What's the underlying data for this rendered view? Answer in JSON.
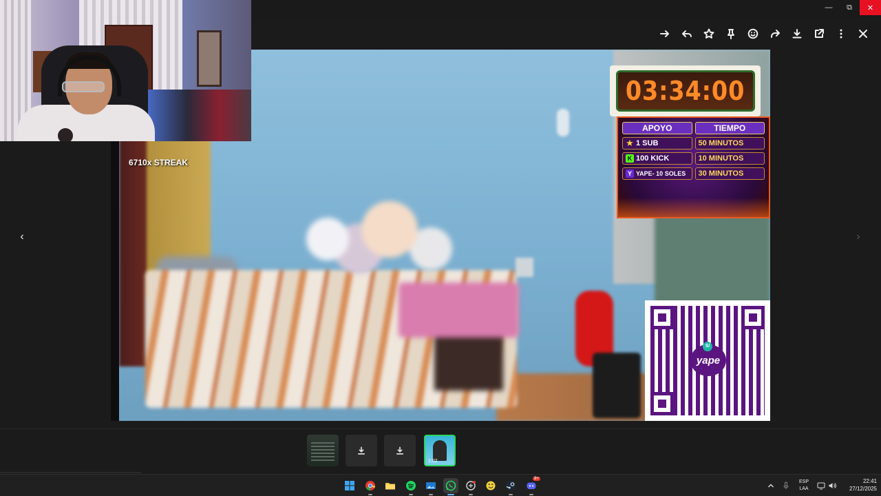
{
  "window": {
    "minimize_glyph": "—",
    "maximize_glyph": "⧉",
    "close_glyph": "✕"
  },
  "toolbar": {
    "buttons": [
      "forward-icon",
      "reply-icon",
      "star-icon",
      "pin-icon",
      "emoji-icon",
      "share-icon",
      "download-icon",
      "open-external-icon",
      "more-vertical-icon",
      "close-icon"
    ]
  },
  "overlay": {
    "streak": "6710x STREAK",
    "timer": "03:34:00",
    "support": {
      "header_left": "APOYO",
      "header_right": "TIEMPO",
      "rows": [
        {
          "left": "1 SUB",
          "right": "50 MINUTOS"
        },
        {
          "left": "100 KICK",
          "right": "10 MINUTOS"
        },
        {
          "left": "YAPE- 10 SOLES",
          "right": "30 MINUTOS"
        }
      ]
    },
    "qr_logo": "yape",
    "qr_badge": "S/"
  },
  "nav": {
    "prev": "‹",
    "next": "›"
  },
  "filmstrip": {
    "thumbs": [
      "document",
      "download",
      "download",
      "video"
    ],
    "active_duration": "1:02"
  },
  "taskbar": {
    "apps": [
      "start",
      "chrome",
      "file-explorer",
      "spotify",
      "photos",
      "whatsapp",
      "capture",
      "emote",
      "steam",
      "discord"
    ],
    "discord_badge": "9+",
    "language_line1": "ESP",
    "language_line2": "LAA",
    "time": "22:41",
    "date": "27/12/2025"
  },
  "colors": {
    "accent_green": "#2cd45a",
    "close_red": "#e81123",
    "timer_orange": "#ff8a28",
    "yape_purple": "#5b1580"
  }
}
